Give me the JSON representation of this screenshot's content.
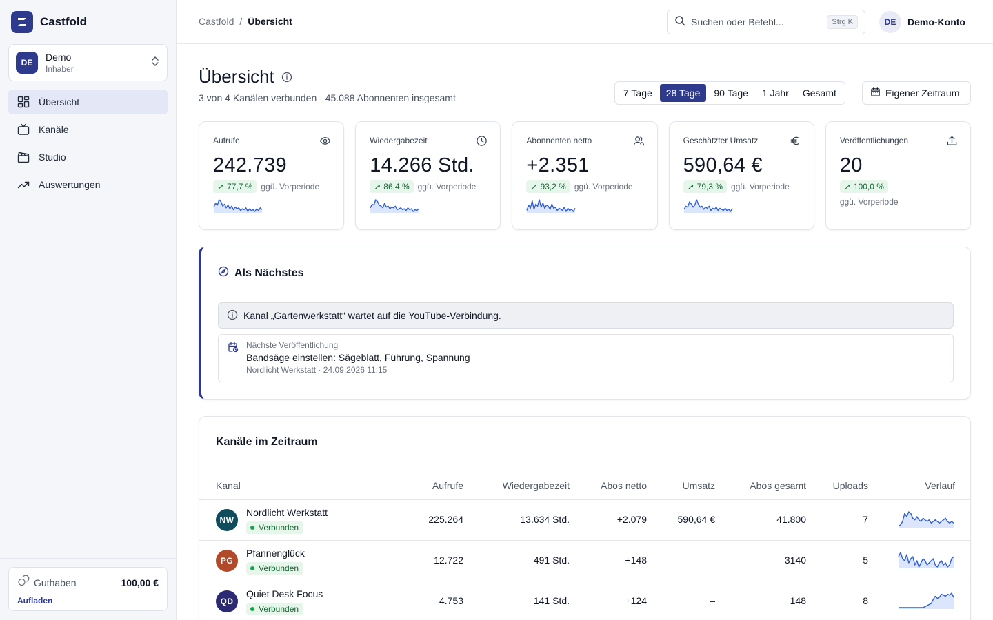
{
  "app": {
    "name": "Castfold"
  },
  "account": {
    "initials": "DE",
    "name": "Demo",
    "role": "Inhaber"
  },
  "nav": [
    {
      "label": "Übersicht",
      "icon": "grid-icon",
      "active": true
    },
    {
      "label": "Kanäle",
      "icon": "tv-icon",
      "active": false
    },
    {
      "label": "Studio",
      "icon": "clapperboard-icon",
      "active": false
    },
    {
      "label": "Auswertungen",
      "icon": "trend-icon",
      "active": false
    }
  ],
  "credit": {
    "label": "Guthaben",
    "value": "100,00 €",
    "action": "Aufladen"
  },
  "breadcrumb": {
    "root": "Castfold",
    "separator": "/",
    "current": "Übersicht"
  },
  "search": {
    "placeholder": "Suchen oder Befehl...",
    "shortcut": "Strg K"
  },
  "user": {
    "initials": "DE",
    "name": "Demo-Konto"
  },
  "header": {
    "title": "Übersicht",
    "subtitle": "3 von 4 Kanälen verbunden · 45.088 Abonnenten insgesamt",
    "ranges": [
      "7 Tage",
      "28 Tage",
      "90 Tage",
      "1 Jahr",
      "Gesamt"
    ],
    "active_range": "28 Tage",
    "custom_range": "Eigener Zeitraum"
  },
  "stats": [
    {
      "label": "Aufrufe",
      "icon": "eye-icon",
      "value": "242.739",
      "delta": "77,7 %",
      "delta_sub": "ggü. Vorperiode",
      "spark": [
        14,
        18,
        16,
        22,
        20,
        15,
        17,
        13,
        16,
        12,
        15,
        11,
        14,
        12,
        13,
        10,
        12,
        11,
        13,
        9,
        12,
        10,
        11,
        9,
        12,
        10,
        13,
        11
      ]
    },
    {
      "label": "Wiedergabezeit",
      "icon": "clock-icon",
      "value": "14.266 Std.",
      "delta": "86,4 %",
      "delta_sub": "ggü. Vorperiode",
      "spark": [
        12,
        16,
        15,
        21,
        19,
        15,
        14,
        12,
        17,
        13,
        14,
        11,
        13,
        12,
        14,
        10,
        11,
        12,
        10,
        11,
        9,
        12,
        10,
        11,
        8,
        10,
        9,
        11
      ]
    },
    {
      "label": "Abonnenten netto",
      "icon": "users-icon",
      "value": "+2.351",
      "delta": "93,2 %",
      "delta_sub": "ggü. Vorperiode",
      "spark": [
        10,
        15,
        12,
        19,
        11,
        16,
        14,
        20,
        13,
        17,
        12,
        15,
        14,
        11,
        16,
        12,
        13,
        10,
        12,
        11,
        10,
        13,
        9,
        12,
        10,
        11,
        9,
        12
      ]
    },
    {
      "label": "Geschätzter Umsatz",
      "icon": "euro-icon",
      "value": "590,64 €",
      "delta": "79,3 %",
      "delta_sub": "ggü. Vorperiode",
      "spark": [
        11,
        14,
        13,
        18,
        16,
        13,
        15,
        20,
        16,
        13,
        14,
        11,
        13,
        12,
        14,
        10,
        12,
        11,
        13,
        10,
        12,
        11,
        10,
        12,
        10,
        11,
        9,
        12
      ]
    },
    {
      "label": "Veröffentlichungen",
      "icon": "upload-icon",
      "value": "20",
      "delta": "100,0 %",
      "delta_sub": "ggü. Vorperiode",
      "spark": null
    }
  ],
  "next": {
    "title": "Als Nächstes",
    "notice": "Kanal „Gartenwerkstatt“ wartet auf die YouTube-Verbindung.",
    "pub_label": "Nächste Veröffentlichung",
    "pub_title": "Bandsäge einstellen: Sägeblatt, Führung, Spannung",
    "pub_meta": "Nordlicht Werkstatt · 24.09.2026 11:15"
  },
  "channels": {
    "title": "Kanäle im Zeitraum",
    "columns": [
      "Kanal",
      "Aufrufe",
      "Wiedergabezeit",
      "Abos netto",
      "Umsatz",
      "Abos gesamt",
      "Uploads",
      "Verlauf"
    ],
    "rows": [
      {
        "initials": "NW",
        "color": "#0f4c5c",
        "name": "Nordlicht Werkstatt",
        "status": "Verbunden",
        "views": "225.264",
        "watch": "13.634 Std.",
        "subs_net": "+2.079",
        "revenue": "590,64 €",
        "subs_total": "41.800",
        "uploads": "7",
        "spark": [
          6,
          7,
          9,
          14,
          12,
          15,
          14,
          11,
          10,
          12,
          10,
          9,
          11,
          10,
          9,
          10,
          8,
          9,
          10,
          9,
          8,
          9,
          10,
          11,
          9,
          8,
          9,
          8
        ]
      },
      {
        "initials": "PG",
        "color": "#b04a2a",
        "name": "Pfannenglück",
        "status": "Verbunden",
        "views": "12.722",
        "watch": "491 Std.",
        "subs_net": "+148",
        "revenue": "–",
        "subs_total": "3140",
        "uploads": "5",
        "spark": [
          14,
          16,
          13,
          12,
          15,
          11,
          13,
          14,
          10,
          12,
          9,
          11,
          13,
          12,
          10,
          11,
          12,
          13,
          10,
          9,
          11,
          12,
          10,
          11,
          9,
          10,
          13,
          14
        ]
      },
      {
        "initials": "QD",
        "color": "#2b2a73",
        "name": "Quiet Desk Focus",
        "status": "Verbunden",
        "views": "4.753",
        "watch": "141 Std.",
        "subs_net": "+124",
        "revenue": "–",
        "subs_total": "148",
        "uploads": "8",
        "spark": [
          1,
          1,
          1,
          1,
          1,
          1,
          1,
          1,
          1,
          1,
          1,
          1,
          1,
          2,
          3,
          4,
          5,
          9,
          12,
          10,
          11,
          14,
          13,
          12,
          14,
          13,
          15,
          11
        ]
      }
    ]
  },
  "colors": {
    "accent": "#2e3a8c",
    "positive": "#166534",
    "positive_bg": "#e7f6ea",
    "spark": "#2f5fcf"
  }
}
